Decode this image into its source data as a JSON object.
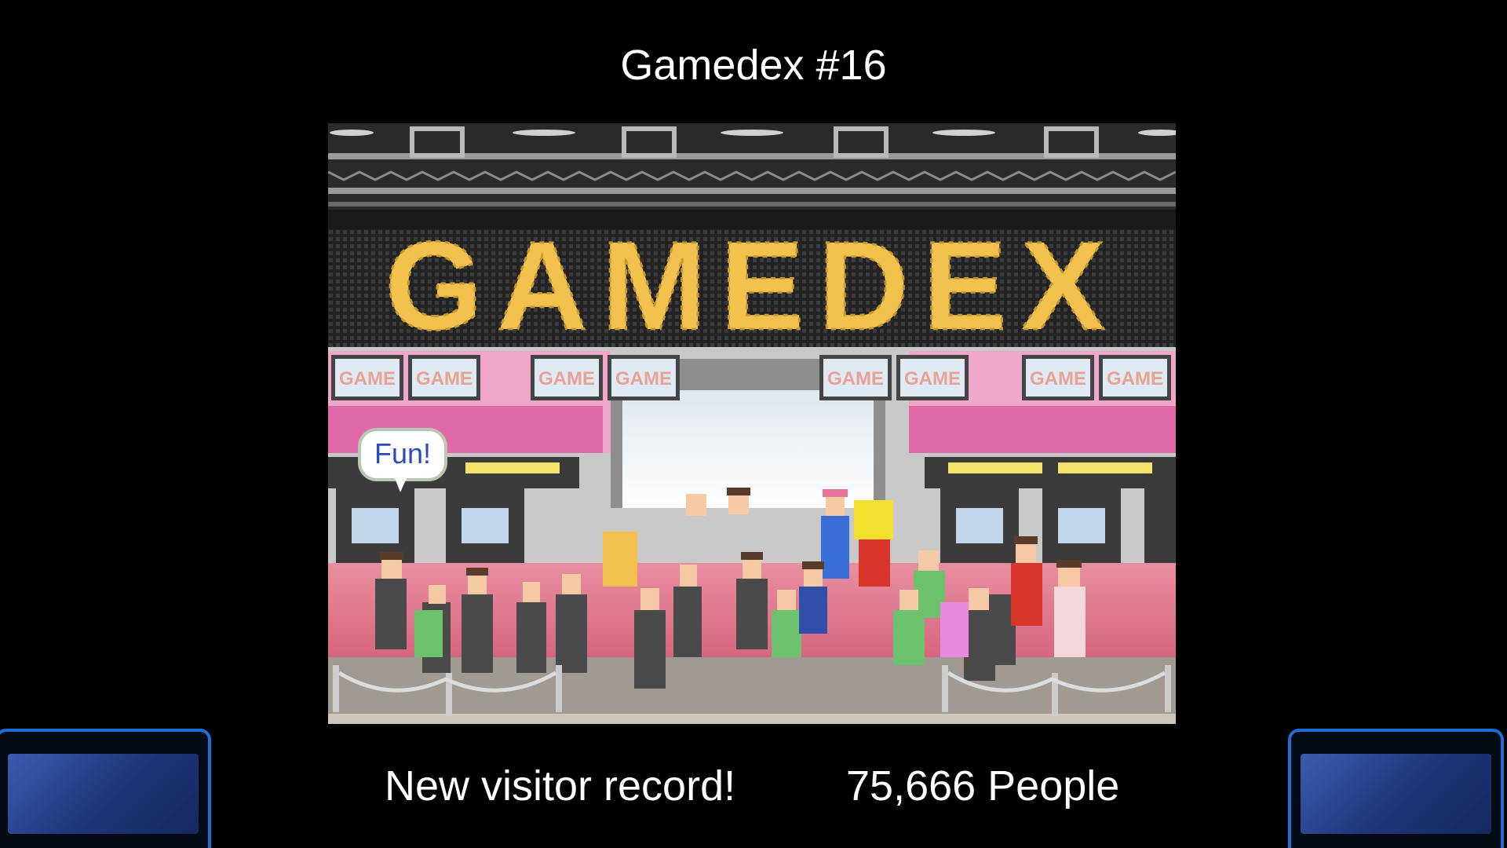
{
  "header": {
    "title": "Gamedex #16"
  },
  "scene": {
    "marquee_text": "GAMEDEX",
    "booth_sign_text": "GAME",
    "speech_bubble": "Fun!"
  },
  "footer": {
    "message": "New visitor record!",
    "visitors": "75,666 People"
  },
  "colors": {
    "background": "#000000",
    "marquee_led": "#f2c14e",
    "carpet": "#e7798f",
    "nav_button_border": "#1c6fd8"
  },
  "icons": {
    "left_button": "nav-button",
    "right_button": "nav-button"
  }
}
